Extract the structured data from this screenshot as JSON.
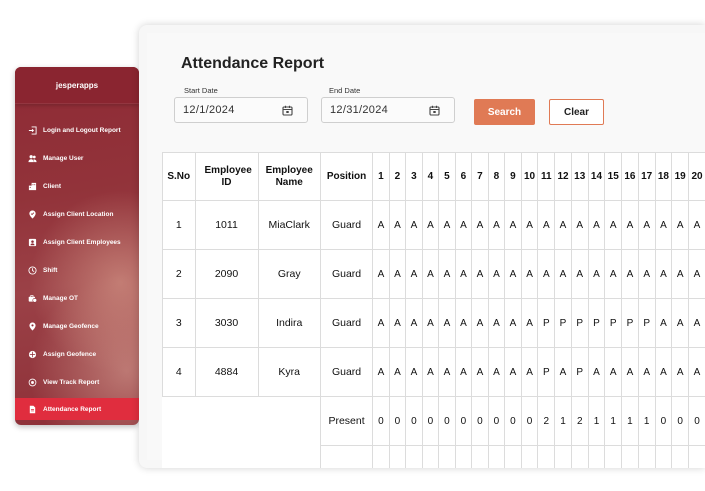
{
  "sidebar": {
    "brand": "jesperapps",
    "items": [
      {
        "label": "Login and Logout Report",
        "icon": "login-icon"
      },
      {
        "label": "Manage User",
        "icon": "users-icon"
      },
      {
        "label": "Client",
        "icon": "building-icon"
      },
      {
        "label": "Assign Client Location",
        "icon": "location-check-icon"
      },
      {
        "label": "Assign Client Employees",
        "icon": "id-badge-icon"
      },
      {
        "label": "Shift",
        "icon": "clock-icon"
      },
      {
        "label": "Manage OT",
        "icon": "briefcase-clock-icon"
      },
      {
        "label": "Manage Geofence",
        "icon": "map-pin-icon"
      },
      {
        "label": "Assign Geofence",
        "icon": "geofence-icon"
      },
      {
        "label": "View Track Report",
        "icon": "track-icon"
      },
      {
        "label": "Attendance Report",
        "icon": "report-icon",
        "active": true
      }
    ]
  },
  "page": {
    "title": "Attendance Report",
    "start_label": "Start Date",
    "start_value": "12/1/2024",
    "end_label": "End Date",
    "end_value": "12/31/2024",
    "search_label": "Search",
    "clear_label": "Clear"
  },
  "table": {
    "headers": {
      "sno": "S.No",
      "employee_id": "Employee ID",
      "employee_name": "Employee Name",
      "position": "Position"
    },
    "days": [
      "1",
      "2",
      "3",
      "4",
      "5",
      "6",
      "7",
      "8",
      "9",
      "10",
      "11",
      "12",
      "13",
      "14",
      "15",
      "16",
      "17",
      "18",
      "19",
      "20"
    ],
    "rows": [
      {
        "sno": "1",
        "id": "1011",
        "name": "MiaClark",
        "position": "Guard",
        "marks": [
          "A",
          "A",
          "A",
          "A",
          "A",
          "A",
          "A",
          "A",
          "A",
          "A",
          "A",
          "A",
          "A",
          "A",
          "A",
          "A",
          "A",
          "A",
          "A",
          "A"
        ]
      },
      {
        "sno": "2",
        "id": "2090",
        "name": "Gray",
        "position": "Guard",
        "marks": [
          "A",
          "A",
          "A",
          "A",
          "A",
          "A",
          "A",
          "A",
          "A",
          "A",
          "A",
          "A",
          "A",
          "A",
          "A",
          "A",
          "A",
          "A",
          "A",
          "A"
        ]
      },
      {
        "sno": "3",
        "id": "3030",
        "name": "Indira",
        "position": "Guard",
        "marks": [
          "A",
          "A",
          "A",
          "A",
          "A",
          "A",
          "A",
          "A",
          "A",
          "A",
          "P",
          "P",
          "P",
          "P",
          "P",
          "P",
          "P",
          "A",
          "A",
          "A"
        ]
      },
      {
        "sno": "4",
        "id": "4884",
        "name": "Kyra",
        "position": "Guard",
        "marks": [
          "A",
          "A",
          "A",
          "A",
          "A",
          "A",
          "A",
          "A",
          "A",
          "A",
          "P",
          "A",
          "P",
          "A",
          "A",
          "A",
          "A",
          "A",
          "A",
          "A"
        ]
      }
    ],
    "present_label": "Present",
    "present_counts": [
      "0",
      "0",
      "0",
      "0",
      "0",
      "0",
      "0",
      "0",
      "0",
      "0",
      "2",
      "1",
      "2",
      "1",
      "1",
      "1",
      "1",
      "0",
      "0",
      "0"
    ]
  }
}
